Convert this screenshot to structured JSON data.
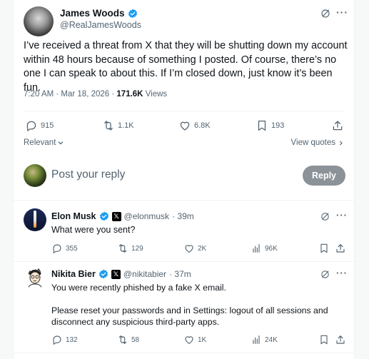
{
  "main_post": {
    "author_name": "James Woods",
    "author_handle": "@RealJamesWoods",
    "text": "I’ve received a threat from X that they will be shutting down my account within 48 hours because of something I posted. Of course, there’s no one I can speak to about this. If I’m closed down, just know it’s been fun.",
    "timestamp": "7:20 AM · Mar 18, 2026 · ",
    "views_count": "171.6K",
    "views_label": " Views",
    "replies": "915",
    "reposts": "1.1K",
    "likes": "6.8K",
    "bookmarks": "193"
  },
  "sort": {
    "relevant_label": "Relevant",
    "view_quotes_label": "View quotes"
  },
  "composer": {
    "placeholder": "Post your reply",
    "reply_button": "Reply"
  },
  "replies": [
    {
      "author_name": "Elon Musk",
      "author_handle": "@elonmusk",
      "time": "· 39m",
      "text": "What were you sent?",
      "replies": "355",
      "reposts": "129",
      "likes": "2K",
      "views": "96K"
    },
    {
      "author_name": "Nikita Bier",
      "author_handle": "@nikitabier",
      "time": "· 37m",
      "text_line1": "You were recently phished by a fake X email.",
      "text_line2": "Please reset your passwords and in Settings: logout of all sessions and",
      "text_line3": "disconnect any suspicious third-party apps.",
      "replies": "132",
      "reposts": "58",
      "likes": "1K",
      "views": "24K"
    }
  ],
  "colors": {
    "verified": "#1d9bf0",
    "muted": "#536471",
    "text": "#0f1419",
    "reply_button": "#8b9298"
  }
}
